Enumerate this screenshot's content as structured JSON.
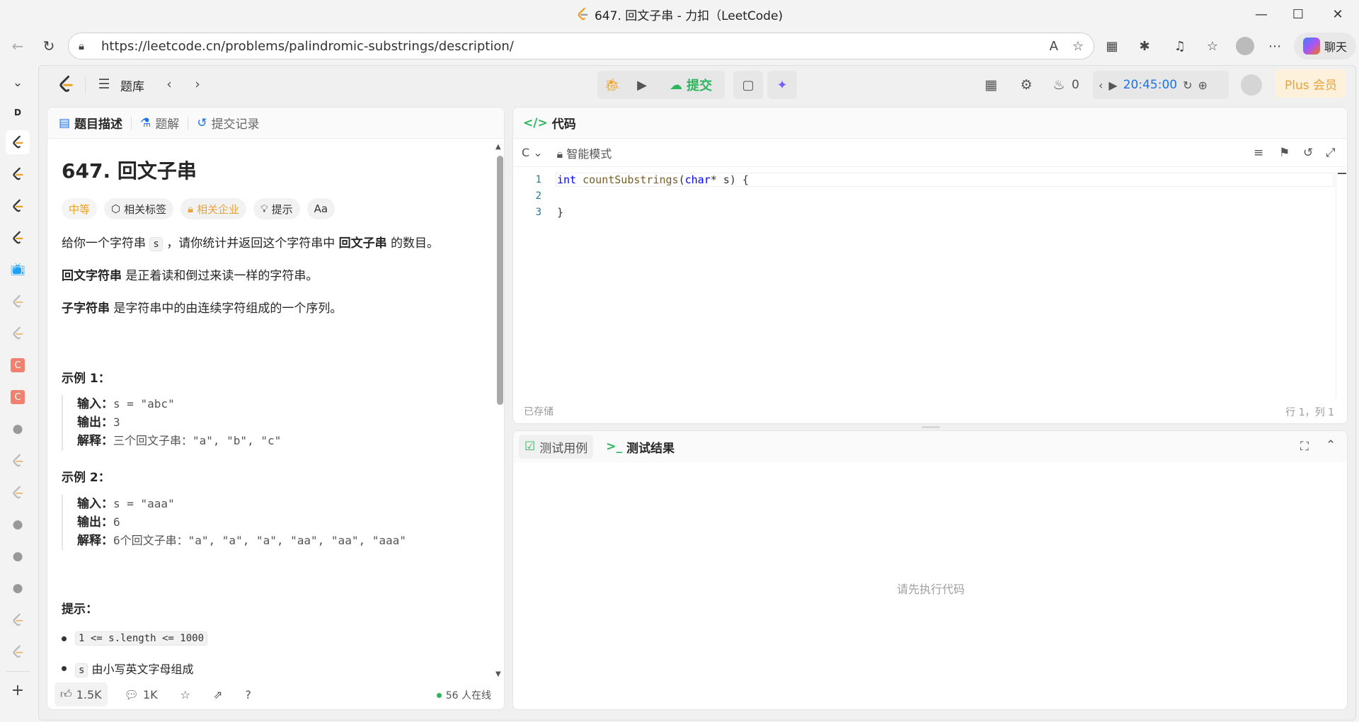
{
  "window": {
    "title": "647. 回文子串 - 力扣（LeetCode)",
    "controls": {
      "minimize": "—",
      "maximize": "☐",
      "close": "✕"
    }
  },
  "browser": {
    "url": "https://leetcode.cn/problems/palindromic-substrings/description/",
    "chat_label": "聊天",
    "sidebar_icons": [
      "chevron-down-icon",
      "dict-icon",
      "leetcode-icon",
      "leetcode-icon",
      "leetcode-icon",
      "leetcode-icon",
      "bilibili-icon",
      "leetcode-icon",
      "leetcode-icon",
      "c-icon",
      "c-icon",
      "github-icon",
      "leetcode-icon",
      "leetcode-icon",
      "github-icon",
      "github-icon",
      "github-icon",
      "leetcode-icon",
      "leetcode-icon"
    ],
    "add_label": "+"
  },
  "header": {
    "problem_list": "题库",
    "submit": "提交",
    "fire_count": "0",
    "timer": "20:45:00",
    "plus": "Plus 会员"
  },
  "left_panel": {
    "tabs": [
      {
        "label": "题目描述",
        "active": true
      },
      {
        "label": "题解",
        "active": false
      },
      {
        "label": "提交记录",
        "active": false
      }
    ],
    "title": "647. 回文子串",
    "tags": [
      "中等",
      "相关标签",
      "相关企业",
      "提示",
      "Aa"
    ],
    "desc_1_pre": "给你一个字符串 ",
    "desc_1_code": "s",
    "desc_1_mid": " ，请你统计并返回这个字符串中 ",
    "desc_1_bold": "回文子串",
    "desc_1_post": " 的数目。",
    "desc_2_bold": "回文字符串",
    "desc_2_post": " 是正着读和倒过来读一样的字符串。",
    "desc_3_bold": "子字符串",
    "desc_3_post": " 是字符串中的由连续字符组成的一个序列。",
    "examples": [
      {
        "title": "示例 1：",
        "input_label": "输入：",
        "input": "s = \"abc\"",
        "output_label": "输出：",
        "output": "3",
        "explain_label": "解释：",
        "explain": "三个回文子串：\"a\", \"b\", \"c\""
      },
      {
        "title": "示例 2：",
        "input_label": "输入：",
        "input": "s = \"aaa\"",
        "output_label": "输出：",
        "output": "6",
        "explain_label": "解释：",
        "explain": "6个回文子串：\"a\", \"a\", \"a\", \"aa\", \"aa\", \"aaa\""
      }
    ],
    "hints_title": "提示：",
    "hint_1": "1 <= s.length <= 1000",
    "hint_2_code": "s",
    "hint_2_text": "由小写英文字母组成",
    "footer": {
      "likes": "1.5K",
      "comments": "1K",
      "online": "56 人在线"
    }
  },
  "code_panel": {
    "title": "代码",
    "language": "C",
    "mode": "智能模式",
    "lines": [
      "1",
      "2",
      "3"
    ],
    "code_kw": "int",
    "code_fn": "countSubstrings",
    "code_ty": "char",
    "code_line3": "}",
    "saved": "已存储",
    "cursor": "行 1，列 1"
  },
  "result_panel": {
    "tab_cases": "测试用例",
    "tab_result": "测试结果",
    "empty": "请先执行代码"
  }
}
